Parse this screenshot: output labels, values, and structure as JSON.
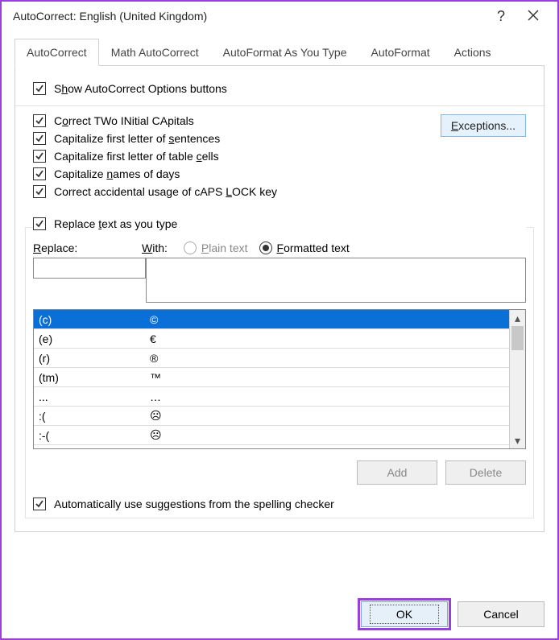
{
  "window": {
    "title": "AutoCorrect: English (United Kingdom)"
  },
  "tabs": {
    "autocorrect": "AutoCorrect",
    "math": "Math AutoCorrect",
    "autoformat_type": "AutoFormat As You Type",
    "autoformat": "AutoFormat",
    "actions": "Actions"
  },
  "checkboxes": {
    "show_options": "Show AutoCorrect Options buttons",
    "two_initial": "Correct TWo INitial CApitals",
    "cap_sentences": "Capitalize first letter of sentences",
    "cap_cells": "Capitalize first letter of table cells",
    "cap_days": "Capitalize names of days",
    "caps_lock": "Correct accidental usage of cAPS LOCK key",
    "replace_as_type": "Replace text as you type",
    "auto_sugg": "Automatically use suggestions from the spelling checker"
  },
  "labels": {
    "exceptions": "Exceptions...",
    "replace": "Replace:",
    "with": "With:",
    "plain_text": "Plain text",
    "formatted_text": "Formatted text",
    "add": "Add",
    "delete": "Delete",
    "ok": "OK",
    "cancel": "Cancel"
  },
  "table": {
    "rows": [
      {
        "replace": "(c)",
        "with": "©"
      },
      {
        "replace": "(e)",
        "with": "€"
      },
      {
        "replace": "(r)",
        "with": "®"
      },
      {
        "replace": "(tm)",
        "with": "™"
      },
      {
        "replace": "...",
        "with": "…"
      },
      {
        "replace": ":(",
        "with": "☹"
      },
      {
        "replace": ":-(",
        "with": "☹"
      }
    ]
  }
}
